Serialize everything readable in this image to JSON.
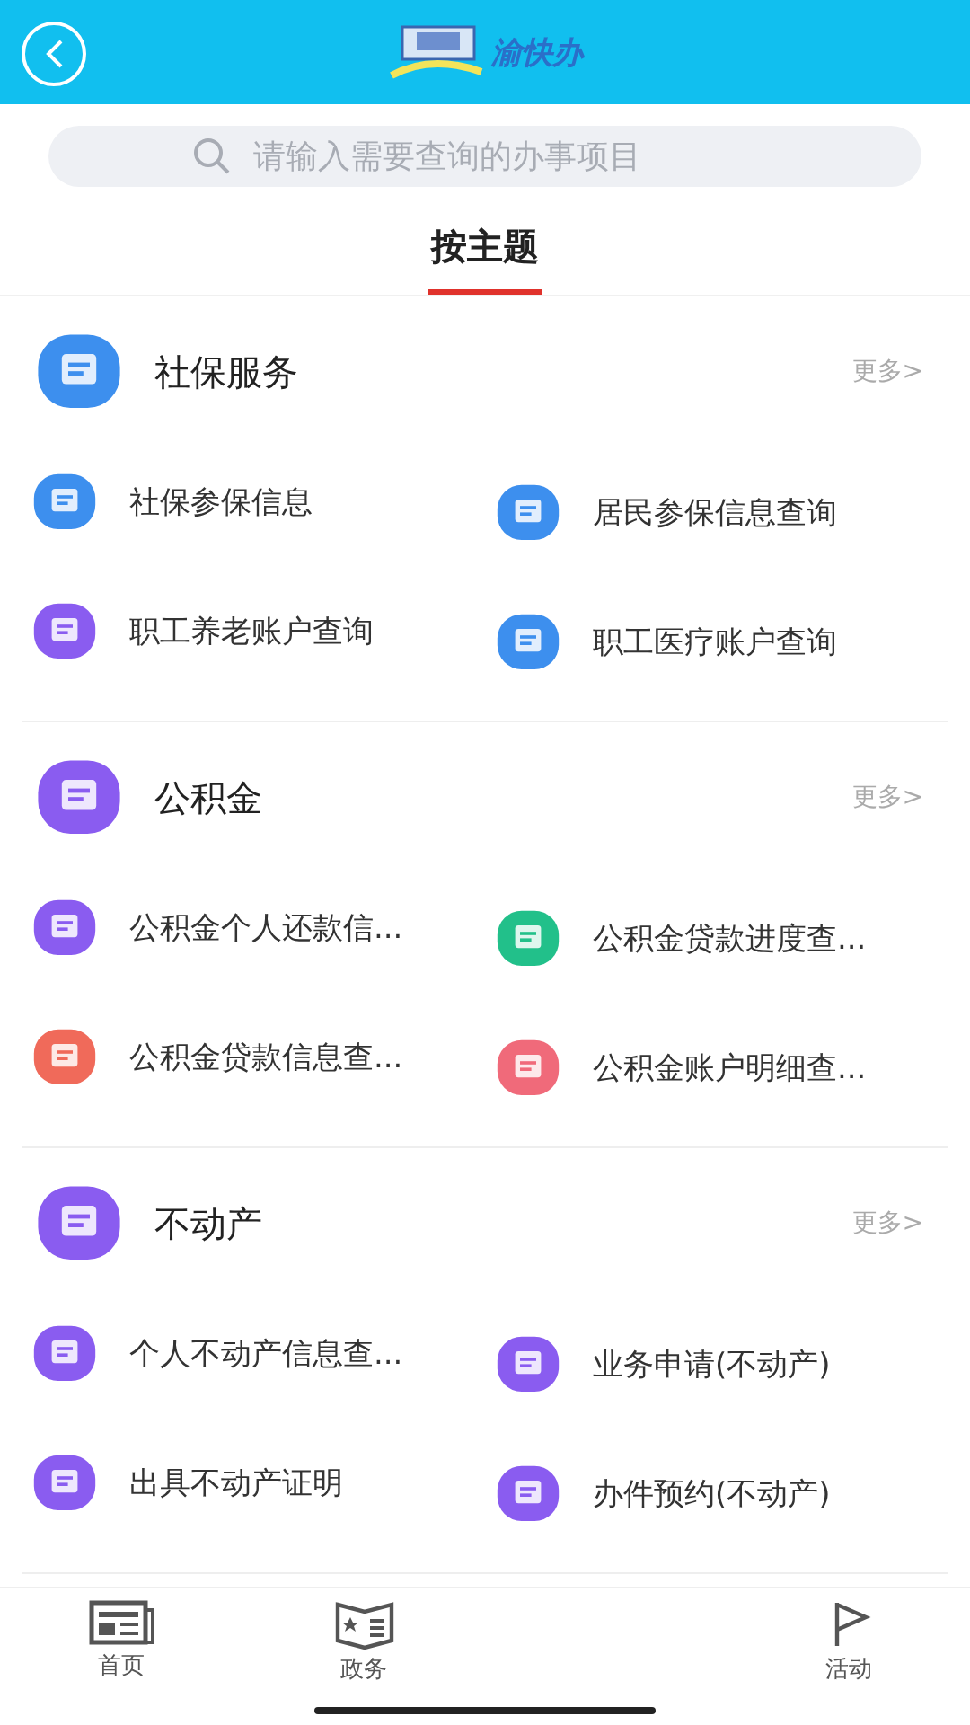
{
  "header": {
    "logo_text": "渝快办"
  },
  "search": {
    "placeholder": "请输入需要查询的办事项目"
  },
  "tabs": [
    {
      "label": "按主题",
      "selected": true
    }
  ],
  "sections": [
    {
      "title": "社保服务",
      "color": "#3d8fee",
      "more": "更多>",
      "items": [
        {
          "label": "社保参保信息",
          "color": "#3d8fee"
        },
        {
          "label": "居民参保信息查询",
          "color": "#3d8fee"
        },
        {
          "label": "职工养老账户查询",
          "color": "#8a5cf0"
        },
        {
          "label": "职工医疗账户查询",
          "color": "#3d8fee"
        }
      ]
    },
    {
      "title": "公积金",
      "color": "#8a5cf0",
      "more": "更多>",
      "items": [
        {
          "label": "公积金个人还款信...",
          "color": "#8a5cf0"
        },
        {
          "label": "公积金贷款进度查...",
          "color": "#22c08a"
        },
        {
          "label": "公积金贷款信息查...",
          "color": "#f06a5a"
        },
        {
          "label": "公积金账户明细查...",
          "color": "#f06a7a"
        }
      ]
    },
    {
      "title": "不动产",
      "color": "#8a5cf0",
      "more": "更多>",
      "items": [
        {
          "label": "个人不动产信息查...",
          "color": "#8a5cf0"
        },
        {
          "label": "业务申请(不动产)",
          "color": "#8a5cf0"
        },
        {
          "label": "出具不动产证明",
          "color": "#8a5cf0"
        },
        {
          "label": "办件预约(不动产)",
          "color": "#8a5cf0"
        }
      ]
    }
  ],
  "bottom_nav": [
    {
      "label": "首页",
      "kind": "news"
    },
    {
      "label": "政务",
      "kind": "book"
    },
    {
      "kind": "hidden"
    },
    {
      "label": "活动",
      "kind": "flag"
    }
  ]
}
